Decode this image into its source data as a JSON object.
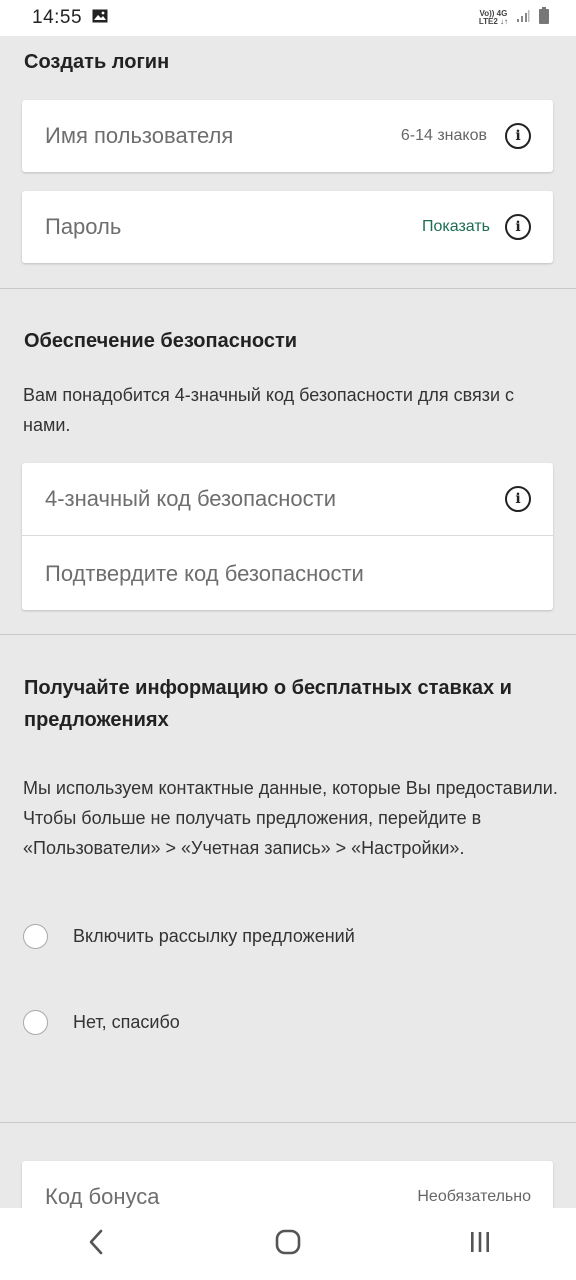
{
  "status_bar": {
    "time": "14:55",
    "network_line1": "Vo)) 4G",
    "network_line2": "LTE2 ↓↑"
  },
  "login": {
    "title": "Создать логин",
    "username": {
      "label": "Имя пользователя",
      "hint": "6-14 знаков"
    },
    "password": {
      "label": "Пароль",
      "show_link": "Показать"
    }
  },
  "security": {
    "title": "Обеспечение безопасности",
    "description": "Вам понадобится 4-значный код безопасности для связи с нами.",
    "code_label": "4-значный код безопасности",
    "confirm_label": "Подтвердите код безопасности"
  },
  "offers": {
    "title": "Получайте информацию о бесплатных ставках и предложениях",
    "description": "Мы используем контактные данные, которые Вы предоставили. Чтобы больше не получать предложения, перейдите в «Пользователи» > «Учетная запись» > «Настройки».",
    "options": [
      "Включить рассылку предложений",
      "Нет, спасибо"
    ]
  },
  "bonus": {
    "label": "Код бонуса",
    "hint": "Необязательно"
  },
  "colors": {
    "accent_link": "#1c6e52",
    "background": "#e8e9e8",
    "card": "#ffffff"
  },
  "icons": [
    "gallery-icon",
    "signal-icon",
    "battery-icon",
    "info-icon",
    "back-icon",
    "home-icon",
    "recents-icon"
  ]
}
